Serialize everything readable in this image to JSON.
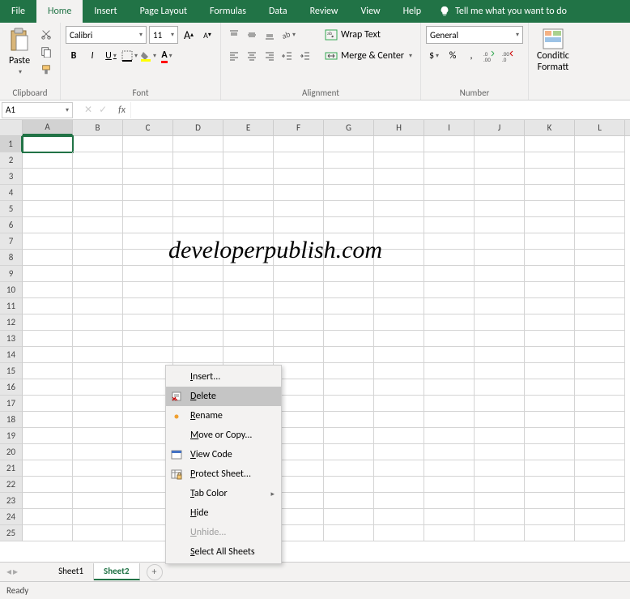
{
  "ribbon": {
    "tabs": [
      "File",
      "Home",
      "Insert",
      "Page Layout",
      "Formulas",
      "Data",
      "Review",
      "View",
      "Help"
    ],
    "active_tab_index": 1,
    "tell_me": "Tell me what you want to do",
    "groups": {
      "clipboard": {
        "label": "Clipboard",
        "paste": "Paste"
      },
      "font": {
        "label": "Font",
        "name": "Calibri",
        "size": "11",
        "increase": "A",
        "decrease": "A",
        "bold": "B",
        "italic": "I",
        "underline": "U"
      },
      "alignment": {
        "label": "Alignment",
        "wrap": "Wrap Text",
        "merge": "Merge & Center"
      },
      "number": {
        "label": "Number",
        "format": "General",
        "currency": "$",
        "percent": "%",
        "comma": ","
      },
      "cond": {
        "line1": "Conditic",
        "line2": "Formatt"
      }
    }
  },
  "formula_bar": {
    "name_box": "A1",
    "fx": "fx"
  },
  "grid": {
    "columns": [
      "A",
      "B",
      "C",
      "D",
      "E",
      "F",
      "G",
      "H",
      "I",
      "J",
      "K",
      "L"
    ],
    "rows": 25,
    "active_cell": "A1",
    "watermark": "developerpublish.com"
  },
  "context_menu": {
    "items": [
      {
        "label": "Insert...",
        "accel": "I",
        "icon": "",
        "disabled": false
      },
      {
        "label": "Delete",
        "accel": "D",
        "icon": "delete",
        "disabled": false,
        "hovered": true
      },
      {
        "label": "Rename",
        "accel": "R",
        "icon": "dot",
        "disabled": false
      },
      {
        "label": "Move or Copy...",
        "accel": "M",
        "icon": "",
        "disabled": false
      },
      {
        "label": "View Code",
        "accel": "V",
        "icon": "code",
        "disabled": false
      },
      {
        "label": "Protect Sheet...",
        "accel": "P",
        "icon": "protect",
        "disabled": false
      },
      {
        "label": "Tab Color",
        "accel": "T",
        "icon": "",
        "disabled": false,
        "submenu": true
      },
      {
        "label": "Hide",
        "accel": "H",
        "icon": "",
        "disabled": false
      },
      {
        "label": "Unhide...",
        "accel": "U",
        "icon": "",
        "disabled": true
      },
      {
        "label": "Select All Sheets",
        "accel": "S",
        "icon": "",
        "disabled": false
      }
    ]
  },
  "sheets": {
    "tabs": [
      "Sheet1",
      "Sheet2"
    ],
    "active_index": 1
  },
  "status": "Ready"
}
